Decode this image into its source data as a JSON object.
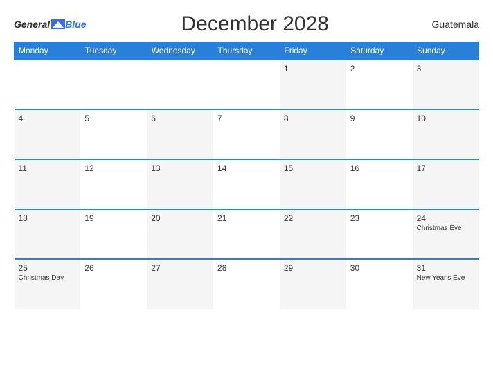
{
  "header": {
    "logo_general": "General",
    "logo_blue": "Blue",
    "title": "December 2028",
    "country": "Guatemala"
  },
  "weekdays": [
    "Monday",
    "Tuesday",
    "Wednesday",
    "Thursday",
    "Friday",
    "Saturday",
    "Sunday"
  ],
  "weeks": [
    [
      {
        "day": "",
        "empty": true
      },
      {
        "day": "",
        "empty": true
      },
      {
        "day": "",
        "empty": true
      },
      {
        "day": "",
        "empty": true
      },
      {
        "day": "1",
        "holiday": ""
      },
      {
        "day": "2",
        "holiday": ""
      },
      {
        "day": "3",
        "holiday": ""
      }
    ],
    [
      {
        "day": "4",
        "holiday": ""
      },
      {
        "day": "5",
        "holiday": ""
      },
      {
        "day": "6",
        "holiday": ""
      },
      {
        "day": "7",
        "holiday": ""
      },
      {
        "day": "8",
        "holiday": ""
      },
      {
        "day": "9",
        "holiday": ""
      },
      {
        "day": "10",
        "holiday": ""
      }
    ],
    [
      {
        "day": "11",
        "holiday": ""
      },
      {
        "day": "12",
        "holiday": ""
      },
      {
        "day": "13",
        "holiday": ""
      },
      {
        "day": "14",
        "holiday": ""
      },
      {
        "day": "15",
        "holiday": ""
      },
      {
        "day": "16",
        "holiday": ""
      },
      {
        "day": "17",
        "holiday": ""
      }
    ],
    [
      {
        "day": "18",
        "holiday": ""
      },
      {
        "day": "19",
        "holiday": ""
      },
      {
        "day": "20",
        "holiday": ""
      },
      {
        "day": "21",
        "holiday": ""
      },
      {
        "day": "22",
        "holiday": ""
      },
      {
        "day": "23",
        "holiday": ""
      },
      {
        "day": "24",
        "holiday": "Christmas Eve"
      }
    ],
    [
      {
        "day": "25",
        "holiday": "Christmas Day"
      },
      {
        "day": "26",
        "holiday": ""
      },
      {
        "day": "27",
        "holiday": ""
      },
      {
        "day": "28",
        "holiday": ""
      },
      {
        "day": "29",
        "holiday": ""
      },
      {
        "day": "30",
        "holiday": ""
      },
      {
        "day": "31",
        "holiday": "New Year's Eve"
      }
    ]
  ]
}
